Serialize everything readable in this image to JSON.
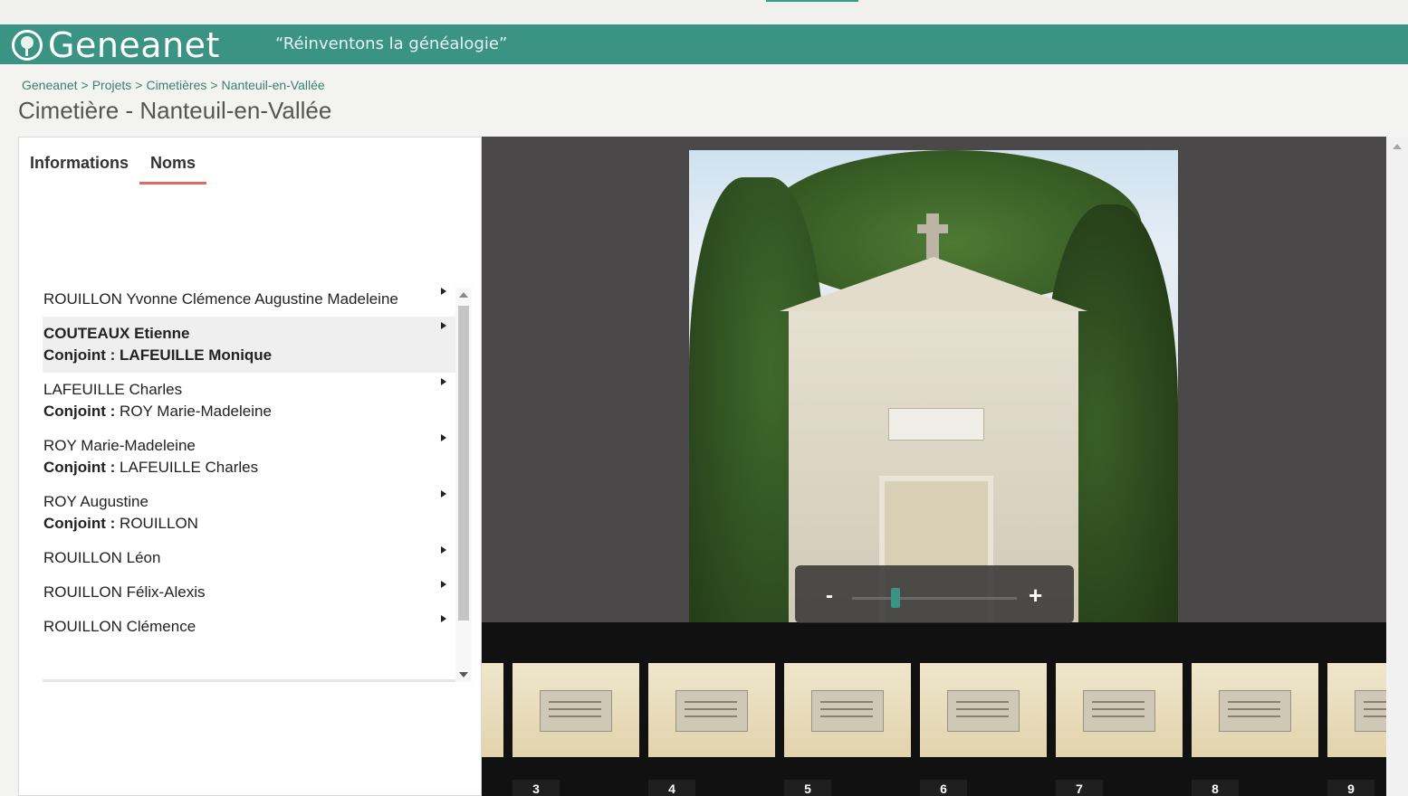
{
  "brand": {
    "logo_text": "Geneanet",
    "slogan": "“Réinventons la généalogie”"
  },
  "breadcrumb": [
    "Geneanet",
    "Projets",
    "Cimetières",
    "Nanteuil-en-Vallée"
  ],
  "breadcrumb_sep": ">",
  "page_title": "Cimetière - Nanteuil-en-Vallée",
  "tabs": [
    {
      "label": "Informations",
      "active": false
    },
    {
      "label": "Noms",
      "active": true
    }
  ],
  "spouse_label": "Conjoint :",
  "names": [
    {
      "name": "ROUILLON Yvonne Clémence Augustine Madeleine",
      "spouse": null,
      "selected": false
    },
    {
      "name": "COUTEAUX Etienne",
      "spouse": "LAFEUILLE Monique",
      "selected": true
    },
    {
      "name": "LAFEUILLE Charles",
      "spouse": "ROY Marie-Madeleine",
      "selected": false
    },
    {
      "name": "ROY Marie-Madeleine",
      "spouse": "LAFEUILLE Charles",
      "selected": false
    },
    {
      "name": "ROY Augustine",
      "spouse": "ROUILLON",
      "selected": false
    },
    {
      "name": "ROUILLON Léon",
      "spouse": null,
      "selected": false
    },
    {
      "name": "ROUILLON Félix-Alexis",
      "spouse": null,
      "selected": false
    },
    {
      "name": "ROUILLON Clémence",
      "spouse": null,
      "selected": false
    }
  ],
  "viewer": {
    "zoom_minus": "-",
    "zoom_plus": "+",
    "zoom_level_fraction": 0.25,
    "accent_color": "#3b9483"
  },
  "thumbnails": [
    "3",
    "4",
    "5",
    "6",
    "7",
    "8",
    "9"
  ],
  "colors": {
    "brand_green": "#3b9483",
    "tab_underline": "#e06b5f",
    "link_green": "#3b7f72"
  }
}
